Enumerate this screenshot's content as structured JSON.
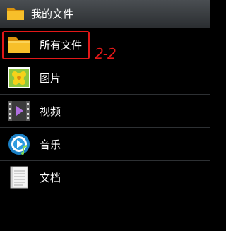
{
  "header": {
    "title": "我的文件",
    "icon": "folder-icon"
  },
  "items": [
    {
      "label": "所有文件",
      "icon": "folder-icon"
    },
    {
      "label": "图片",
      "icon": "image-icon"
    },
    {
      "label": "视频",
      "icon": "video-icon"
    },
    {
      "label": "音乐",
      "icon": "music-icon"
    },
    {
      "label": "文档",
      "icon": "document-icon"
    }
  ],
  "annotation": {
    "text": "2-2",
    "color": "#e21818"
  },
  "colors": {
    "folder": "#f2b51d",
    "header_bg": "#3a3e42",
    "background": "#000000"
  }
}
